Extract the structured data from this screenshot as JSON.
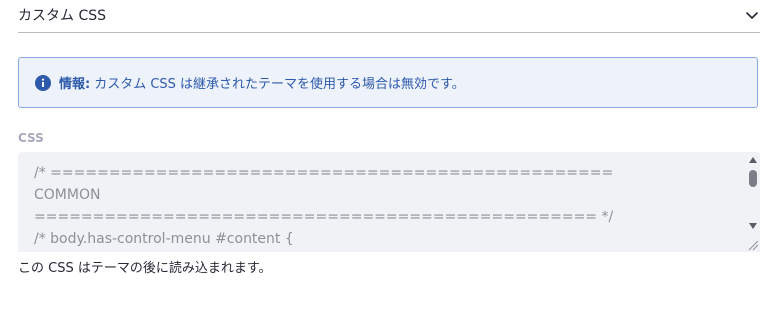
{
  "section": {
    "title": "カスタム CSS",
    "toggle_icon": "chevron-down-icon"
  },
  "alert": {
    "icon": "info-circle-icon",
    "lead": "情報:",
    "message": "カスタム CSS は継承されたテーマを使用する場合は無効です。"
  },
  "css_field": {
    "label": "CSS",
    "code": "/* ================================================\nCOMMON\n================================================ */\n/* body.has-control-menu #content {",
    "help_text": "この CSS はテーマの後に読み込まれます。"
  },
  "colors": {
    "alert_background": "#eef2fa",
    "alert_border": "#89a7e0",
    "alert_text": "#2e5aac",
    "editor_background": "#f1f2f5"
  }
}
